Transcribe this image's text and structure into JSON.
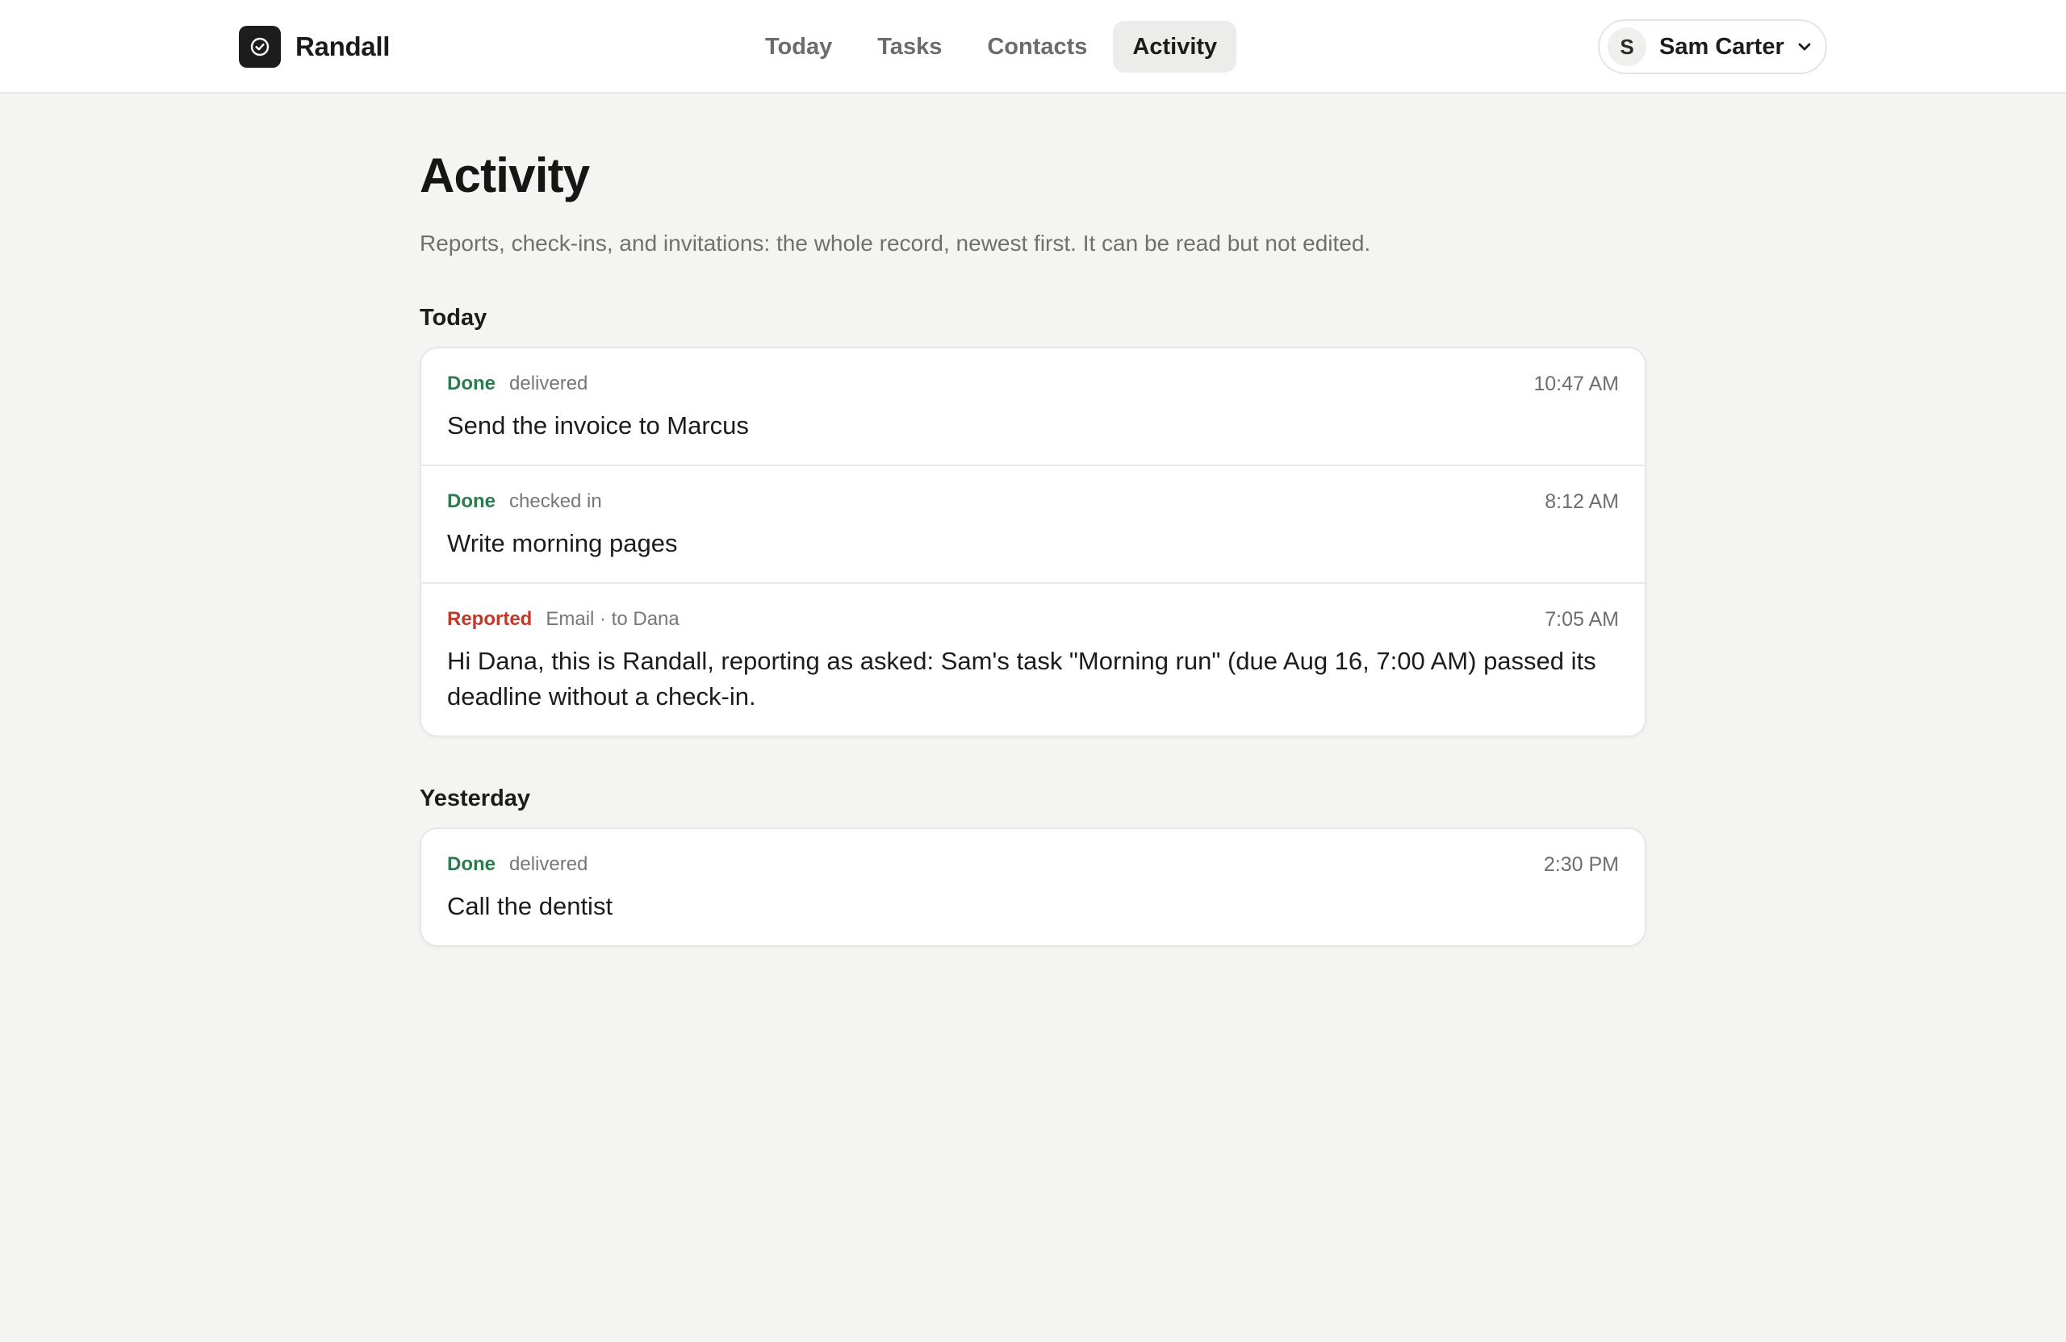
{
  "app": {
    "name": "Randall",
    "logo_icon": "check-circle-icon"
  },
  "nav": {
    "items": [
      {
        "label": "Today",
        "active": false
      },
      {
        "label": "Tasks",
        "active": false
      },
      {
        "label": "Contacts",
        "active": false
      },
      {
        "label": "Activity",
        "active": true
      }
    ]
  },
  "user": {
    "initial": "S",
    "name": "Sam Carter",
    "menu_icon": "chevron-down-icon"
  },
  "page": {
    "title": "Activity",
    "subtitle": "Reports, check-ins, and invitations: the whole record, newest first. It can be read but not edited."
  },
  "sections": [
    {
      "heading": "Today",
      "entries": [
        {
          "status": "Done",
          "kind": "delivered",
          "time": "10:47 AM",
          "text": "Send the invoice to Marcus"
        },
        {
          "status": "Done",
          "kind": "checked in",
          "time": "8:12 AM",
          "text": "Write morning pages"
        },
        {
          "status": "Reported",
          "kind": "Email · to Dana",
          "time": "7:05 AM",
          "text": "Hi Dana, this is Randall, reporting as asked: Sam's task \"Morning run\" (due Aug 16, 7:00 AM) passed its deadline without a check-in."
        }
      ]
    },
    {
      "heading": "Yesterday",
      "entries": [
        {
          "status": "Done",
          "kind": "delivered",
          "time": "2:30 PM",
          "text": "Call the dentist"
        }
      ]
    }
  ],
  "colors": {
    "done": "#2d7a4f",
    "reported": "#c0392b",
    "background": "#f4f4f2",
    "brand": "#1d1d1d"
  }
}
